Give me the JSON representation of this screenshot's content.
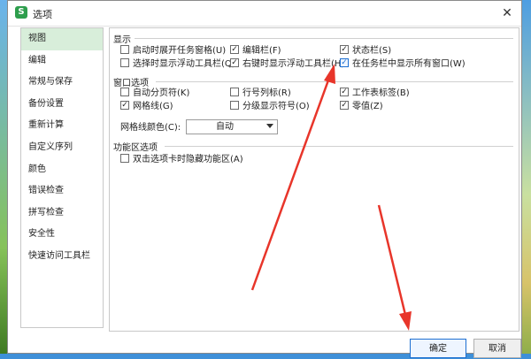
{
  "window": {
    "title": "选项",
    "app_logo": "S",
    "close_glyph": "✕"
  },
  "sidebar": {
    "items": [
      {
        "label": "视图",
        "active": true
      },
      {
        "label": "编辑"
      },
      {
        "label": "常规与保存"
      },
      {
        "label": "备份设置"
      },
      {
        "label": "重新计算"
      },
      {
        "label": "自定义序列"
      },
      {
        "label": "颜色"
      },
      {
        "label": "错误检查"
      },
      {
        "label": "拼写检查"
      },
      {
        "label": "安全性"
      },
      {
        "label": "快速访问工具栏"
      }
    ]
  },
  "display": {
    "title": "显示",
    "options": [
      {
        "label": "启动时展开任务窗格(U)",
        "checked": false
      },
      {
        "label": "编辑栏(F)",
        "checked": true
      },
      {
        "label": "状态栏(S)",
        "checked": true
      },
      {
        "label": "选择时显示浮动工具栏(Q)",
        "checked": false
      },
      {
        "label": "右键时显示浮动工具栏(H)",
        "checked": true
      },
      {
        "label": "在任务栏中显示所有窗口(W)",
        "checked": true
      }
    ]
  },
  "window_options": {
    "title": "窗口选项",
    "options": [
      {
        "label": "自动分页符(K)",
        "checked": false
      },
      {
        "label": "行号列标(R)",
        "checked": false
      },
      {
        "label": "工作表标签(B)",
        "checked": true
      },
      {
        "label": "网格线(G)",
        "checked": true
      },
      {
        "label": "分级显示符号(O)",
        "checked": false
      },
      {
        "label": "零值(Z)",
        "checked": true
      }
    ],
    "grid_color_label": "网格线颜色(C):",
    "grid_color_value": "自动"
  },
  "ribbon": {
    "title": "功能区选项",
    "options": [
      {
        "label": "双击选项卡时隐藏功能区(A)",
        "checked": false
      }
    ]
  },
  "footer": {
    "ok_label": "确定",
    "cancel_label": "取消"
  },
  "colors": {
    "accent": "#1d6fd1",
    "sidebar_active": "#d8eeda",
    "annotation_arrow": "#e8352a"
  }
}
